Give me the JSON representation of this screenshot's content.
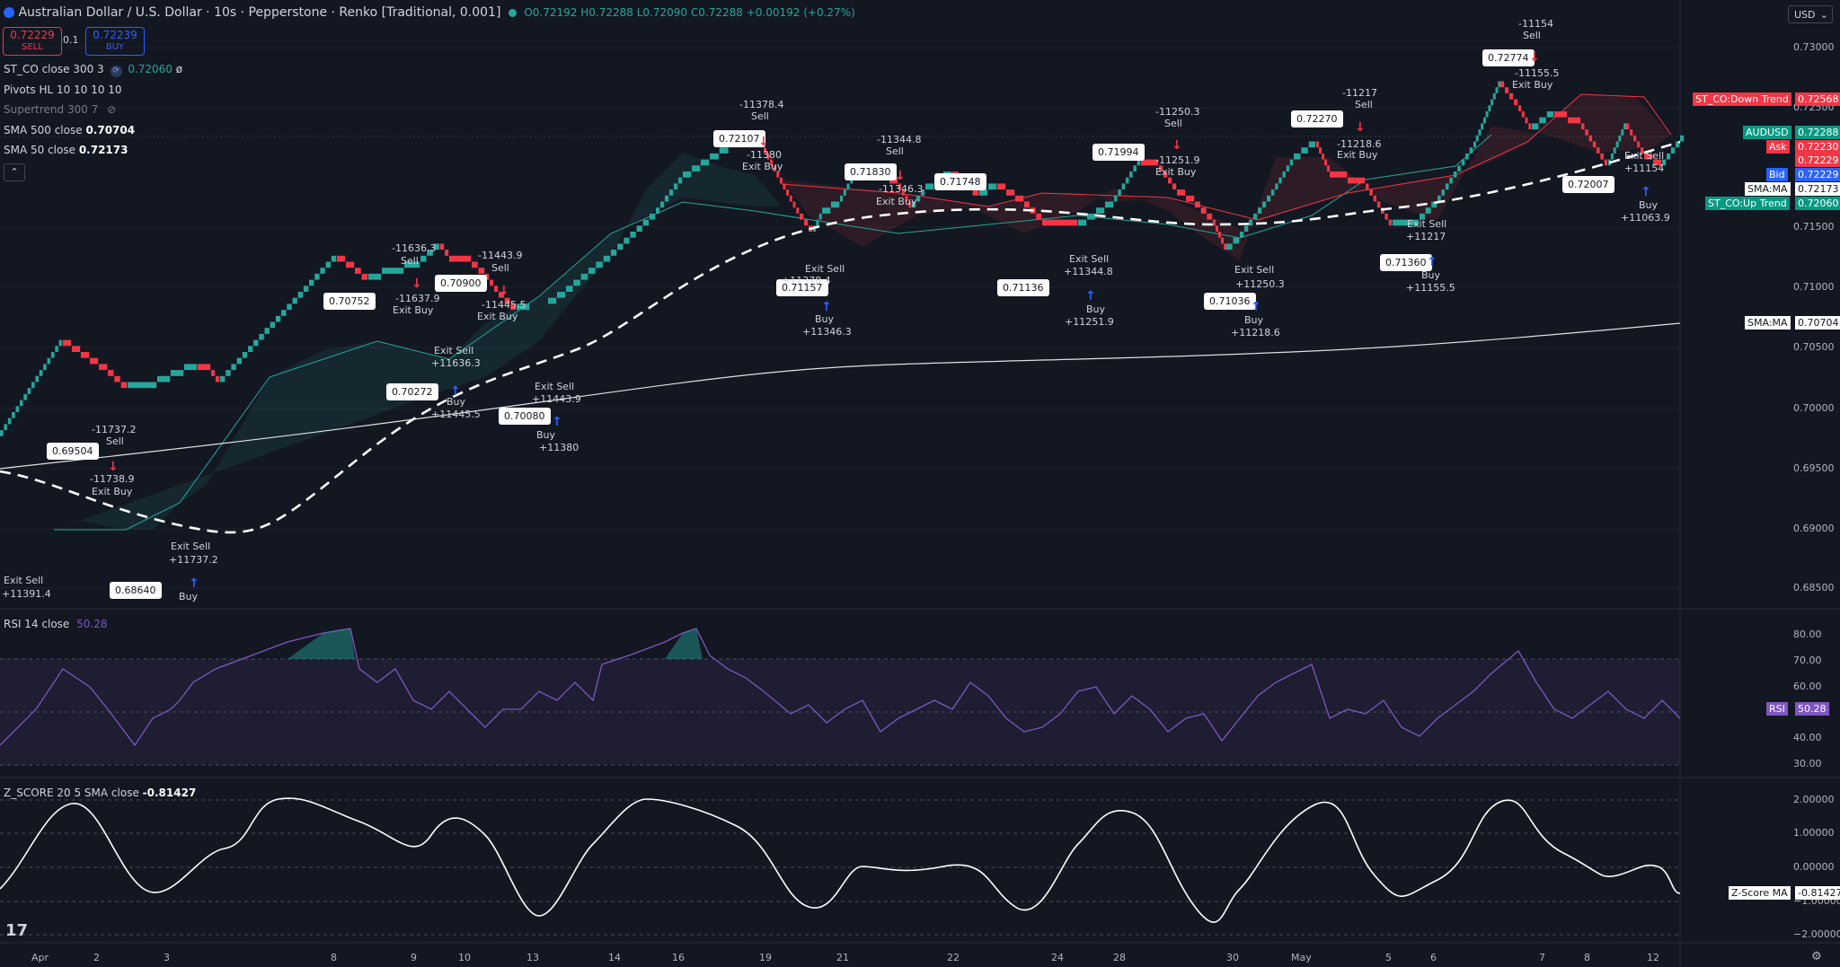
{
  "header": {
    "title": "Australian Dollar / U.S. Dollar · 10s · Pepperstone · Renko [Traditional, 0.001]",
    "ohlc": {
      "o": "O0.72192",
      "h": "H0.72288",
      "l": "L0.72090",
      "c": "C0.72288",
      "chg": "+0.00192 (+0.27%)"
    },
    "sell_price": "0.72229",
    "sell_label": "SELL",
    "qty": "0.1",
    "buy_price": "0.72239",
    "buy_label": "BUY",
    "currency": "USD"
  },
  "indicators": {
    "stco": {
      "label": "ST_CO close 300 3",
      "value": "0.72060"
    },
    "pivots": {
      "label": "Pivots HL 10 10 10 10"
    },
    "supertrend": {
      "label": "Supertrend 300 7"
    },
    "sma500": {
      "label": "SMA 500 close",
      "value": "0.70704"
    },
    "sma50": {
      "label": "SMA 50 close",
      "value": "0.72173"
    },
    "rsi": {
      "label": "RSI 14 close",
      "value": "50.28"
    },
    "zscore": {
      "label": "Z_SCORE 20 5 SMA close",
      "value": "-0.81427"
    }
  },
  "price_axis": [
    "0.73000",
    "0.72500",
    "0.71500",
    "0.71000",
    "0.70500",
    "0.70000",
    "0.69500",
    "0.69000",
    "0.68500"
  ],
  "rsi_axis": [
    "80.00",
    "70.00",
    "60.00",
    "40.00",
    "30.00"
  ],
  "z_axis": [
    "2.00000",
    "1.00000",
    "0.00000",
    "−1.00000",
    "−2.00000"
  ],
  "tags": [
    {
      "text": "ST_CO:Down Trend",
      "bg": "#f23645",
      "fg": "#ffffff"
    },
    {
      "text": "0.72568",
      "bg": "#f23645",
      "fg": "#ffffff"
    },
    {
      "text": "AUDUSD",
      "bg": "#089981",
      "fg": "#ffffff"
    },
    {
      "text": "0.72288",
      "bg": "#089981",
      "fg": "#ffffff"
    },
    {
      "text": "Ask",
      "bg": "#f23645",
      "fg": "#ffffff"
    },
    {
      "text": "0.72230",
      "bg": "#f23645",
      "fg": "#ffffff"
    },
    {
      "text": "0.72229",
      "bg": "#f23645",
      "fg": "#ffffff"
    },
    {
      "text": "Bid",
      "bg": "#2962ff",
      "fg": "#ffffff"
    },
    {
      "text": "0.72229",
      "bg": "#2962ff",
      "fg": "#ffffff"
    },
    {
      "text": "SMA:MA",
      "bg": "#ffffff",
      "fg": "#131722"
    },
    {
      "text": "0.72173",
      "bg": "#ffffff",
      "fg": "#131722"
    },
    {
      "text": "ST_CO:Up Trend",
      "bg": "#089981",
      "fg": "#ffffff"
    },
    {
      "text": "0.72060",
      "bg": "#089981",
      "fg": "#ffffff"
    },
    {
      "text": "SMA:MA",
      "bg": "#ffffff",
      "fg": "#131722"
    },
    {
      "text": "0.70704",
      "bg": "#ffffff",
      "fg": "#131722"
    },
    {
      "text": "RSI",
      "bg": "#7e57c2",
      "fg": "#ffffff"
    },
    {
      "text": "50.28",
      "bg": "#7e57c2",
      "fg": "#ffffff"
    },
    {
      "text": "Z-Score MA",
      "bg": "#ffffff",
      "fg": "#131722"
    },
    {
      "text": "-0.81427",
      "bg": "#ffffff",
      "fg": "#131722"
    }
  ],
  "x_labels": [
    "Apr",
    "2",
    "3",
    "8",
    "9",
    "10",
    "13",
    "14",
    "16",
    "19",
    "21",
    "22",
    "24",
    "28",
    "30",
    "May",
    "5",
    "6",
    "7",
    "8",
    "12"
  ],
  "pivot_labels": [
    "0.69504",
    "0.68640",
    "0.70752",
    "0.70272",
    "0.70900",
    "0.70080",
    "0.72107",
    "0.71157",
    "0.71830",
    "0.71748",
    "0.71136",
    "0.71994",
    "0.71036",
    "0.72270",
    "0.71360",
    "0.72774",
    "0.72007"
  ],
  "signals": [
    "Exit Sell",
    "+11391.4",
    "-11737.2",
    "Sell",
    "-11738.9",
    "Exit Buy",
    "Exit Sell",
    "+11737.2",
    "Buy",
    "-11636.3",
    "Sell",
    "-11637.9",
    "Exit Buy",
    "Exit Sell",
    "+11636.3",
    "Buy",
    "+11445.5",
    "-11443.9",
    "Sell",
    "-11445.5",
    "Exit Buy",
    "Exit Sell",
    "+11443.9",
    "Buy",
    "+11380",
    "-11378.4",
    "Sell",
    "-11380",
    "Exit Buy",
    "Exit Sell",
    "+11378.4",
    "Buy",
    "+11346.3",
    "-11344.8",
    "Sell",
    "-11346.3",
    "Exit Buy",
    "Exit Sell",
    "+11344.8",
    "Buy",
    "+11251.9",
    "-11250.3",
    "Sell",
    "-11251.9",
    "Exit Buy",
    "Exit Sell",
    "+11250.3",
    "Buy",
    "+11218.6",
    "-11217",
    "Sell",
    "-11218.6",
    "Exit Buy",
    "Exit Sell",
    "+11217",
    "Buy",
    "+11155.5",
    "-11154",
    "Sell",
    "-11155.5",
    "Exit Buy",
    "Exit Sell",
    "+11154",
    "Buy",
    "+11063.9"
  ],
  "colors": {
    "up": "#26a69a",
    "down": "#f23645",
    "bg": "#131722",
    "rsi": "#7e57c2",
    "grid": "#2a2e39"
  }
}
